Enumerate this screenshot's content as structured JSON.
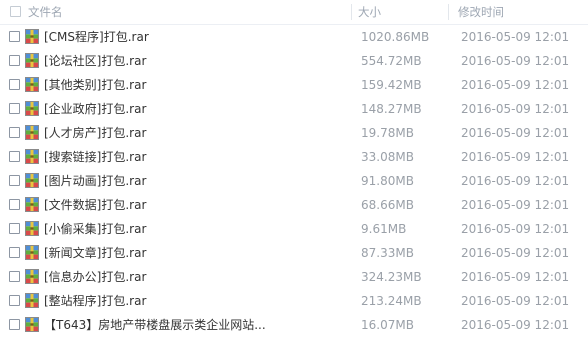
{
  "header": {
    "name_label": "文件名",
    "size_label": "大小",
    "time_label": "修改时间"
  },
  "files": [
    {
      "name": "[CMS程序]打包.rar",
      "size": "1020.86MB",
      "modified": "2016-05-09 12:01"
    },
    {
      "name": "[论坛社区]打包.rar",
      "size": "554.72MB",
      "modified": "2016-05-09 12:01"
    },
    {
      "name": "[其他类别]打包.rar",
      "size": "159.42MB",
      "modified": "2016-05-09 12:01"
    },
    {
      "name": "[企业政府]打包.rar",
      "size": "148.27MB",
      "modified": "2016-05-09 12:01"
    },
    {
      "name": "[人才房产]打包.rar",
      "size": "19.78MB",
      "modified": "2016-05-09 12:01"
    },
    {
      "name": "[搜索链接]打包.rar",
      "size": "33.08MB",
      "modified": "2016-05-09 12:01"
    },
    {
      "name": "[图片动画]打包.rar",
      "size": "91.80MB",
      "modified": "2016-05-09 12:01"
    },
    {
      "name": "[文件数据]打包.rar",
      "size": "68.66MB",
      "modified": "2016-05-09 12:01"
    },
    {
      "name": "[小偷采集]打包.rar",
      "size": "9.61MB",
      "modified": "2016-05-09 12:01"
    },
    {
      "name": "[新闻文章]打包.rar",
      "size": "87.33MB",
      "modified": "2016-05-09 12:01"
    },
    {
      "name": "[信息办公]打包.rar",
      "size": "324.23MB",
      "modified": "2016-05-09 12:01"
    },
    {
      "name": "[整站程序]打包.rar",
      "size": "213.24MB",
      "modified": "2016-05-09 12:01"
    },
    {
      "name": "【T643】房地产带楼盘展示类企业网站...",
      "size": "16.07MB",
      "modified": "2016-05-09 12:01"
    }
  ]
}
